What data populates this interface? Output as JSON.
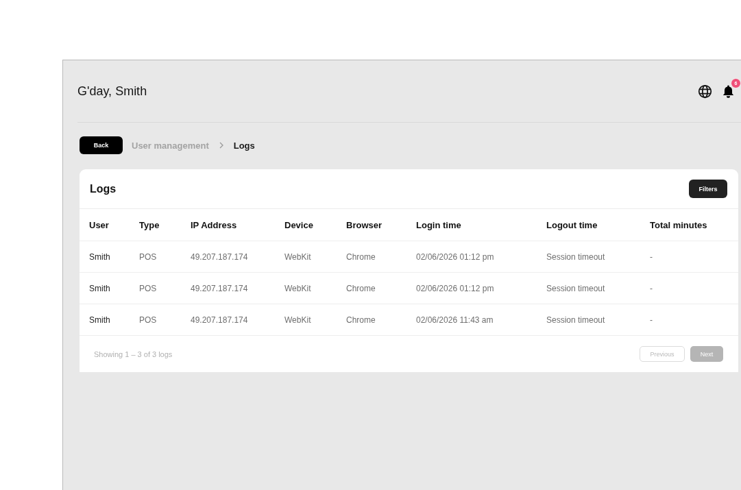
{
  "header": {
    "greeting": "G'day, Smith",
    "notifications": {
      "count": "6"
    }
  },
  "breadcrumb": {
    "back_button": "Back",
    "items": [
      {
        "label": "User management",
        "current": false
      },
      {
        "label": "Logs",
        "current": true
      }
    ]
  },
  "logs_card": {
    "title": "Logs",
    "filters_button": "Filters",
    "table": {
      "columns": [
        "User",
        "Type",
        "IP Address",
        "Device",
        "Browser",
        "Login time",
        "Logout time",
        "Total minutes"
      ],
      "rows": [
        [
          "Smith",
          "POS",
          "49.207.187.174",
          "WebKit",
          "Chrome",
          "02/06/2026 01:12 pm",
          "Session timeout",
          "-"
        ],
        [
          "Smith",
          "POS",
          "49.207.187.174",
          "WebKit",
          "Chrome",
          "02/06/2026 01:12 pm",
          "Session timeout",
          "-"
        ],
        [
          "Smith",
          "POS",
          "49.207.187.174",
          "WebKit",
          "Chrome",
          "02/06/2026 11:43 am",
          "Session timeout",
          "-"
        ]
      ]
    },
    "footer": {
      "summary": "Showing 1 – 3 of 3 logs",
      "previous": {
        "label": "Previous",
        "disabled": true
      },
      "next": {
        "label": "Next",
        "disabled": true
      }
    }
  }
}
